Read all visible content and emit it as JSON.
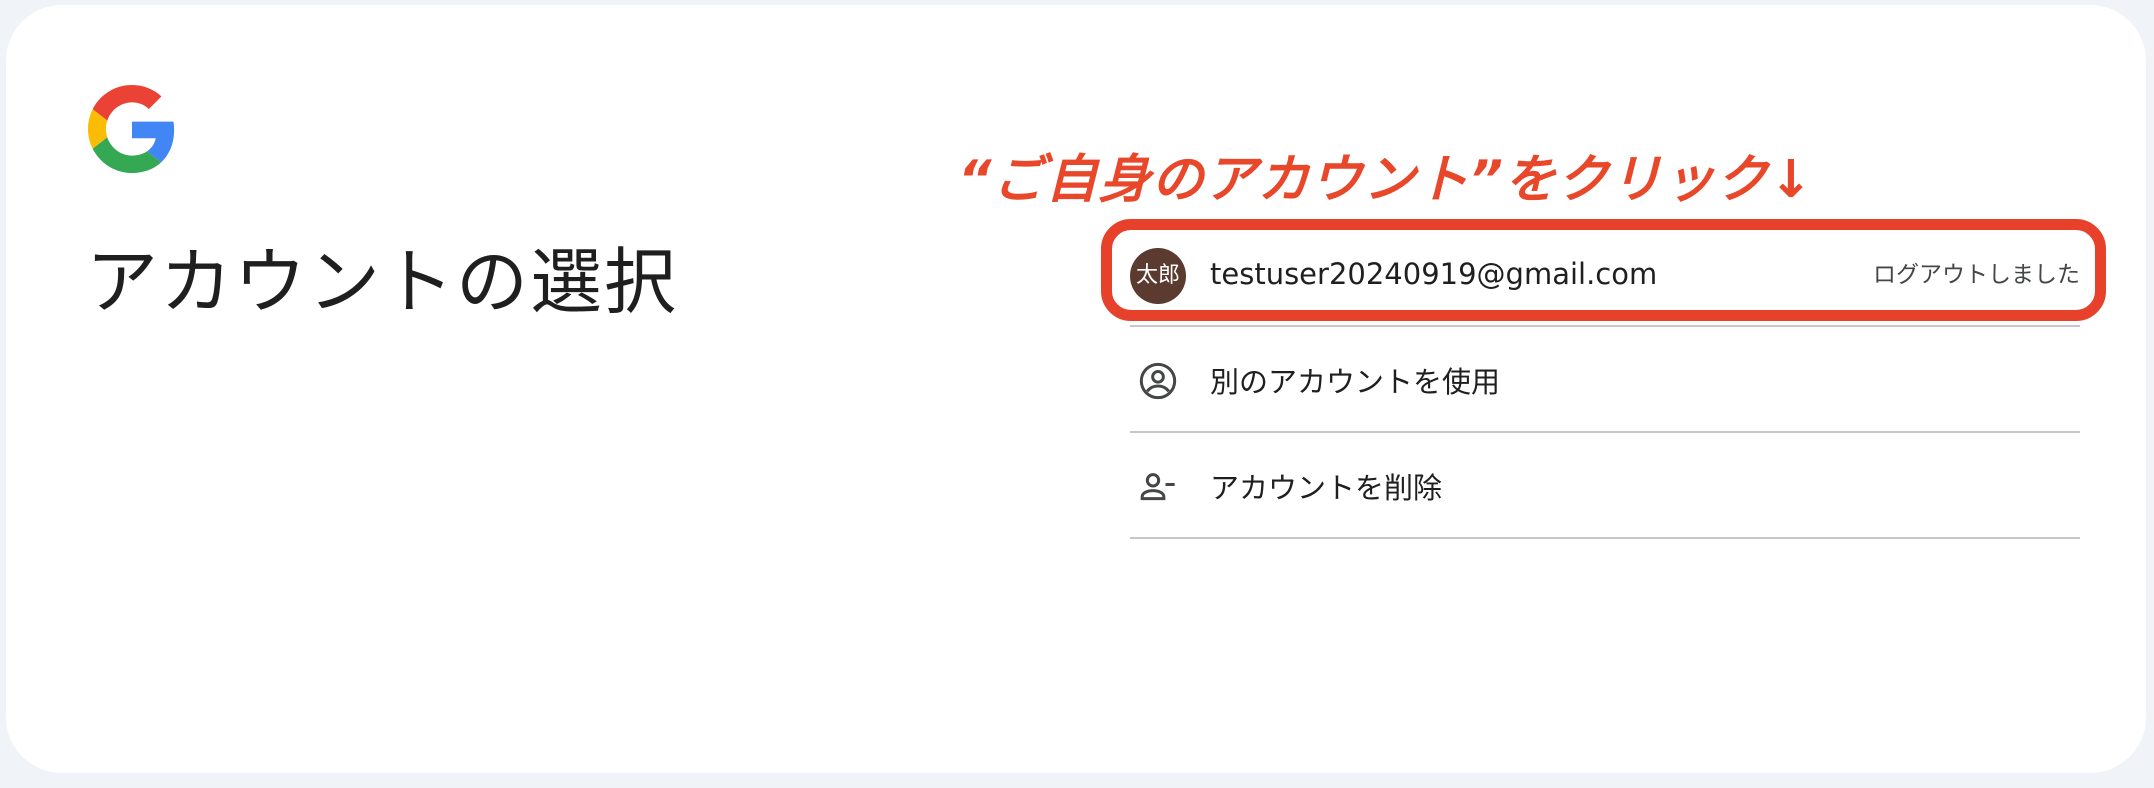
{
  "page": {
    "title": "アカウントの選択"
  },
  "annotation": {
    "text": "“ご自身のアカウント”をクリック↓",
    "color": "#e8472a"
  },
  "accounts": [
    {
      "avatar_text": "太郎",
      "email": "testuser20240919@gmail.com",
      "status": "ログアウトしました"
    }
  ],
  "actions": {
    "use_another": "別のアカウントを使用",
    "remove_account": "アカウントを削除"
  },
  "colors": {
    "highlight": "#e8412b",
    "avatar_bg": "#5b3a30",
    "google_red": "#EA4335",
    "google_yellow": "#FBBC05",
    "google_green": "#34A853",
    "google_blue": "#4285F4"
  },
  "icons": {
    "logo": "google-g-icon",
    "use_another": "account-circle-icon",
    "remove_account": "person-remove-icon"
  }
}
